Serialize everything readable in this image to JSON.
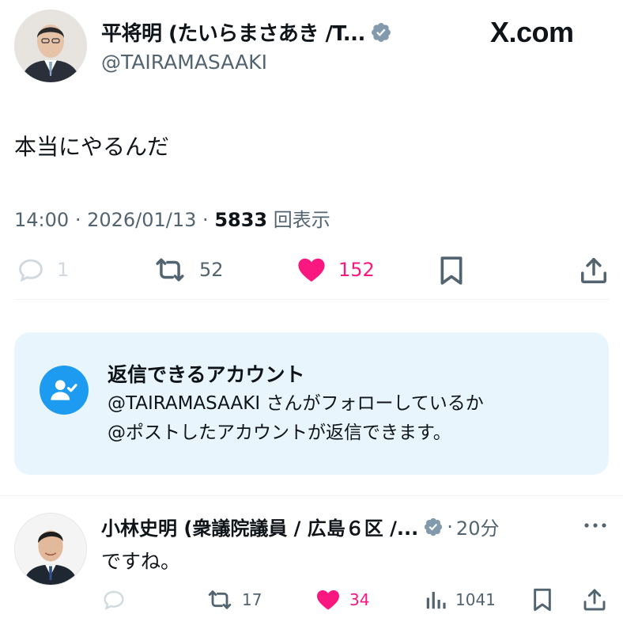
{
  "brand": {
    "label": "X.com"
  },
  "tweet": {
    "author_name": "平将明 (たいらまさあき /T...",
    "handle": "@TAIRAMASAAKI",
    "text": "本当にやるんだ",
    "time": "14:00",
    "date": "2026/01/13",
    "views": "5833",
    "views_label": "回表示",
    "replies": "1",
    "retweets": "52",
    "likes": "152"
  },
  "reply_notice": {
    "title": "返信できるアカウント",
    "line1": "@TAIRAMASAAKI さんがフォローしているか",
    "line2": "@ポストしたアカウントが返信できます。"
  },
  "reply": {
    "author_name": "小林史明 (衆議院議員 / 広島６区 /...",
    "time": "20分",
    "text": "ですね。",
    "retweets": "17",
    "likes": "34",
    "views": "1041"
  },
  "colors": {
    "like": "#f91880",
    "verified": "#829aab",
    "accent": "#1d9bf0",
    "notice_bg": "#e8f5fd"
  }
}
